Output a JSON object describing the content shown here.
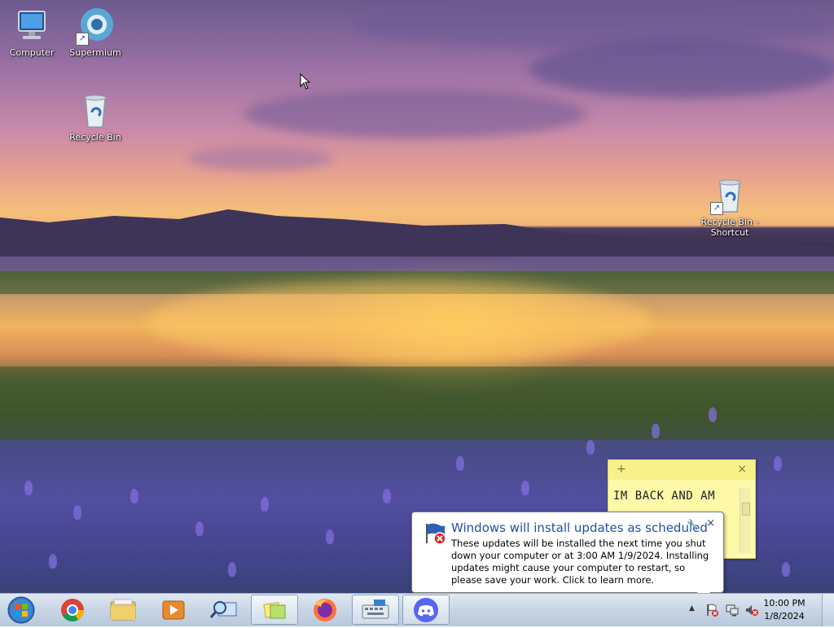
{
  "desktop": {
    "icons": [
      {
        "label": "Computer"
      },
      {
        "label": "Supermium"
      },
      {
        "label": "Recycle Bin"
      },
      {
        "label": "Recycle Bin - Shortcut"
      }
    ]
  },
  "sticky_note": {
    "add_glyph": "+",
    "close_glyph": "×",
    "text": "IM BACK AND AM"
  },
  "notification": {
    "title": "Windows will install updates as scheduled",
    "body": "These updates will be installed the next time you shut down your computer or at 3:00 AM 1/9/2024. Installing updates might cause your computer to restart, so please save your work. Click to learn more.",
    "close_glyph": "×"
  },
  "taskbar": {
    "pinned": [
      {
        "name": "Google Chrome"
      },
      {
        "name": "Windows Explorer"
      },
      {
        "name": "Media Player"
      },
      {
        "name": "Search"
      },
      {
        "name": "Sticky Notes"
      },
      {
        "name": "Firefox"
      },
      {
        "name": "On-Screen Keyboard"
      },
      {
        "name": "Discord"
      }
    ],
    "tray": {
      "expand_glyph": "▲",
      "time": "10:00 PM",
      "date": "1/8/2024"
    }
  },
  "colors": {
    "taskbar": "#c8d5e4",
    "sticky": "#fdf9a8",
    "balloon_title": "#1f4fa8"
  }
}
